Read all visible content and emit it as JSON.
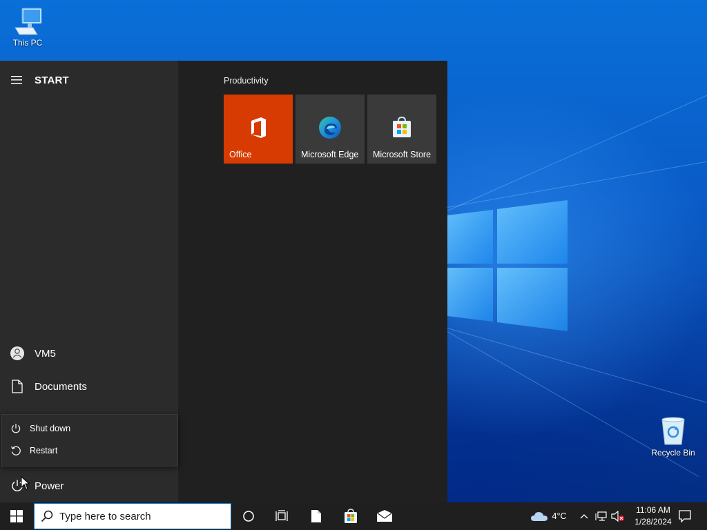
{
  "desktop": {
    "icons": [
      {
        "label": "This PC"
      },
      {
        "label": "Recycle Bin"
      }
    ]
  },
  "start_menu": {
    "title": "START",
    "user": {
      "name": "VM5"
    },
    "documents_label": "Documents",
    "power_label": "Power",
    "power_menu": {
      "shutdown_label": "Shut down",
      "restart_label": "Restart"
    },
    "group": {
      "label": "Productivity",
      "tiles": [
        {
          "label": "Office",
          "color": "#d83b01"
        },
        {
          "label": "Microsoft Edge",
          "color": "#3a3a3a"
        },
        {
          "label": "Microsoft Store",
          "color": "#3a3a3a"
        }
      ]
    }
  },
  "taskbar": {
    "search": {
      "placeholder": "Type here to search"
    },
    "weather": {
      "temp": "4°C"
    },
    "clock": {
      "time": "11:06 AM",
      "date": "1/28/2024"
    }
  },
  "colors": {
    "accent": "#0078d4",
    "office": "#d83b01",
    "start_left": "#2b2b2b",
    "start_right": "#202020",
    "taskbar": "#1f1f1f"
  }
}
